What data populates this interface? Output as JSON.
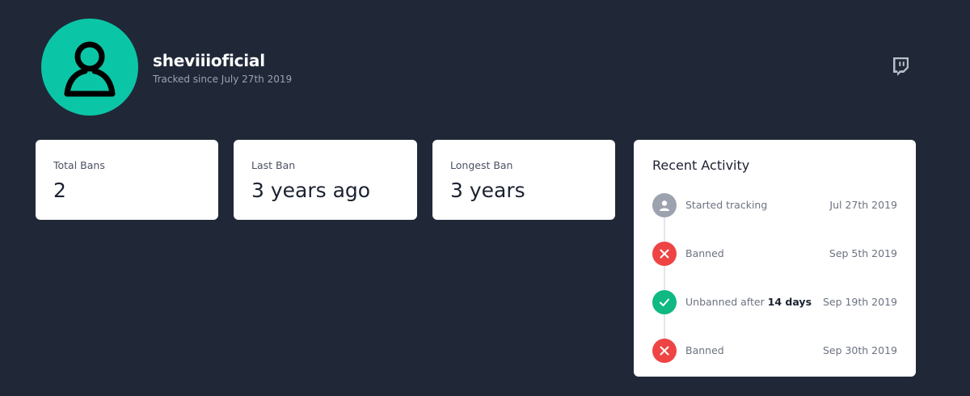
{
  "profile": {
    "username": "sheviiioficial",
    "tracked_since": "Tracked since July 27th 2019",
    "platform_icon": "twitch-icon",
    "avatar_color": "#0bc6a6"
  },
  "stats": [
    {
      "label": "Total Bans",
      "value": "2"
    },
    {
      "label": "Last Ban",
      "value": "3 years ago"
    },
    {
      "label": "Longest Ban",
      "value": "3 years"
    }
  ],
  "activity": {
    "title": "Recent Activity",
    "items": [
      {
        "icon": "user-icon",
        "color": "#9ca3af",
        "text": "Started tracking",
        "date": "Jul 27th 2019"
      },
      {
        "icon": "x-icon",
        "color": "#ef4444",
        "text": "Banned",
        "date": "Sep 5th 2019"
      },
      {
        "icon": "check-icon",
        "color": "#10b981",
        "text": "Unbanned after",
        "text_bold": "14 days",
        "date": "Sep 19th 2019"
      },
      {
        "icon": "x-icon",
        "color": "#ef4444",
        "text": "Banned",
        "date": "Sep 30th 2019"
      }
    ]
  }
}
